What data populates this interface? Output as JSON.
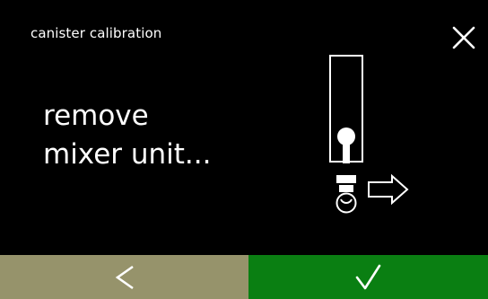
{
  "header": {
    "title": "canister calibration",
    "close_icon": "close-icon"
  },
  "main": {
    "instruction_line1": "remove",
    "instruction_line2": "mixer unit...",
    "illustration_icon": "mixer-unit-removal-icon"
  },
  "footer": {
    "back_icon": "chevron-left-icon",
    "confirm_icon": "checkmark-icon",
    "back_color": "#96936b",
    "confirm_color": "#0a7f12"
  }
}
